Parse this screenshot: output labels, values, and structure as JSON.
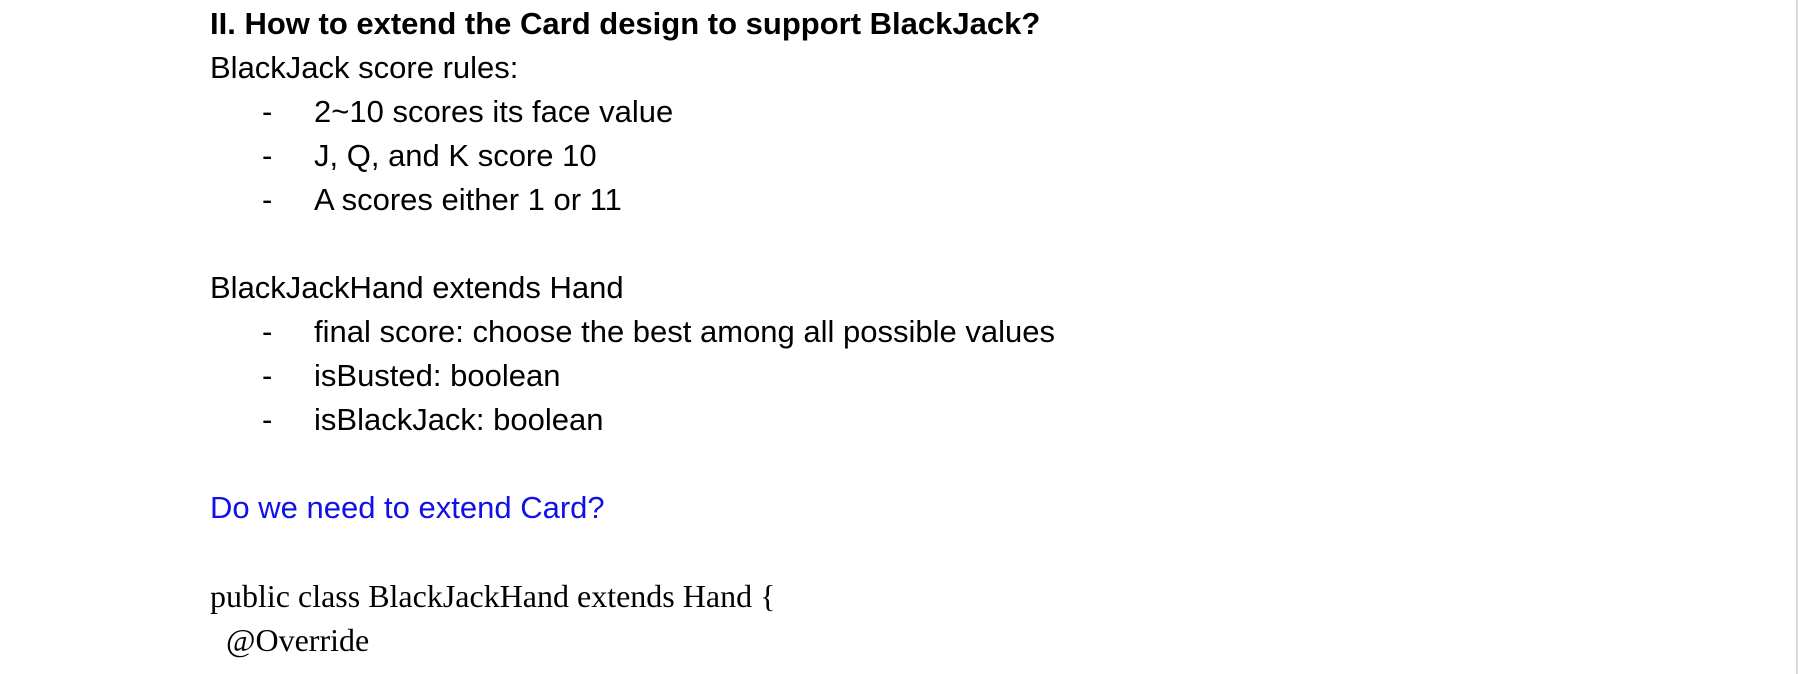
{
  "document": {
    "heading": "II. How to extend the Card design to support BlackJack?",
    "rules": {
      "title": "BlackJack score rules:",
      "items": [
        "2~10 scores its face value",
        "J, Q, and K score 10",
        "A scores either 1 or 11"
      ]
    },
    "hand": {
      "title": "BlackJackHand extends Hand",
      "items": [
        "final score: choose the best among all possible values",
        "isBusted: boolean",
        "isBlackJack: boolean"
      ]
    },
    "question": "Do we need to extend Card?",
    "code": {
      "line1": "public class BlackJackHand extends Hand {",
      "line2": "@Override"
    },
    "bullet_marker": "-",
    "colors": {
      "question": "#1010e8",
      "text": "#000000",
      "background": "#ffffff"
    }
  }
}
